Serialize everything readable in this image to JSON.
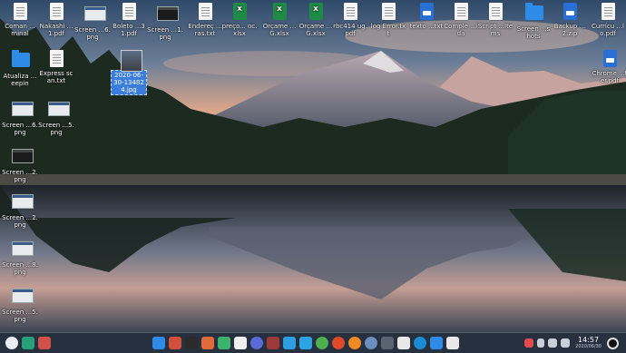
{
  "desktop": {
    "icons": [
      {
        "label": "Coman ...minal",
        "type": "doc"
      },
      {
        "label": "Nakashi ...1.pdf",
        "type": "doc"
      },
      {
        "label": "Screen ...6.png",
        "type": "shot"
      },
      {
        "label": "Boleto ...31.pdf",
        "type": "doc"
      },
      {
        "label": "Screen ...1.png",
        "type": "shot-dark"
      },
      {
        "label": "Endereç ...ras.txt",
        "type": "doc"
      },
      {
        "label": "preço... oc.xlsx",
        "type": "sheet"
      },
      {
        "label": "Orçame ...G.xlsx",
        "type": "sheet"
      },
      {
        "label": "Orçame ...G.xlsx",
        "type": "sheet"
      },
      {
        "label": "rbc414 ug.pdf",
        "type": "doc"
      },
      {
        "label": "log Error.txt",
        "type": "doc"
      },
      {
        "label": "texto ...txt",
        "type": "bluedoc"
      },
      {
        "label": "Comple ...ida",
        "type": "doc"
      },
      {
        "label": "Script ...Items",
        "type": "doc"
      },
      {
        "label": "Screen ...shots",
        "type": "folder"
      },
      {
        "label": "Backup ...2.zip",
        "type": "bluedoc"
      },
      {
        "label": "Currícu ...lo.pdf",
        "type": "doc"
      },
      {
        "label": "Atualiza ...eepin",
        "type": "folder"
      },
      {
        "label": "Express scan.txt",
        "type": "doc"
      },
      {
        "label": "2020-06-30-134824.jpg",
        "type": "photo"
      },
      {
        "label": "Chrome ...ter.pdf",
        "type": "bluedoc"
      },
      {
        "label": "Screen ...6.png",
        "type": "shot"
      },
      {
        "label": "Screen ...5.png",
        "type": "shot"
      },
      {
        "label": "Screen ...2.png",
        "type": "shot-dark"
      },
      {
        "label": "Screen ...2.png",
        "type": "shot"
      },
      {
        "label": "Screen ...8.png",
        "type": "shot"
      },
      {
        "label": "Screen ...5.png",
        "type": "shot"
      }
    ]
  },
  "taskbar": {
    "left_icons": [
      "launcher-icon",
      "multitask-view-icon",
      "show-desktop-icon"
    ],
    "center_icons": [
      "file-manager-icon",
      "terminal-icon",
      "media-player-icon",
      "image-viewer-icon",
      "music-icon",
      "calendar-icon",
      "settings-icon",
      "code-editor-icon",
      "skype-icon",
      "telegram-icon",
      "chrome-icon",
      "brave-icon",
      "firefox-icon",
      "vpn-icon",
      "monitor-icon",
      "camera-icon",
      "kodi-icon",
      "store-icon",
      "clipboard-icon"
    ],
    "tray_icons": [
      "record-icon",
      "volume-icon",
      "network-icon",
      "notification-icon"
    ],
    "clock_time": "14:57",
    "clock_date": "2020/06/30",
    "power_icon": "power-icon"
  },
  "colors": {
    "taskbar_bg": "#26303e",
    "selection": "#3b7ddd",
    "folder": "#2e8ce8",
    "sheet": "#1d8a45"
  }
}
